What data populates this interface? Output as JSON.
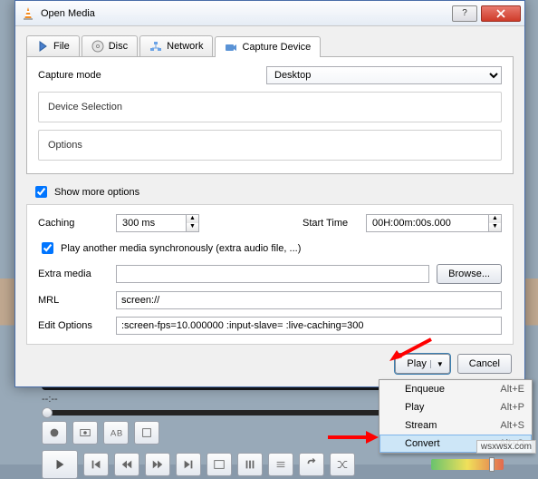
{
  "window": {
    "title": "Open Media"
  },
  "tabs": {
    "file": "File",
    "disc": "Disc",
    "network": "Network",
    "capture": "Capture Device"
  },
  "capture": {
    "mode_label": "Capture mode",
    "mode_value": "Desktop",
    "device_selection_label": "Device Selection",
    "options_label": "Options"
  },
  "show_more_label": "Show more options",
  "adv": {
    "caching_label": "Caching",
    "caching_value": "300 ms",
    "start_label": "Start Time",
    "start_value": "00H:00m:00s.000",
    "play_sync_label": "Play another media synchronously (extra audio file, ...)",
    "extra_label": "Extra media",
    "extra_value": "",
    "browse_label": "Browse...",
    "mrl_label": "MRL",
    "mrl_value": "screen://",
    "edit_label": "Edit Options",
    "edit_value": ":screen-fps=10.000000 :input-slave= :live-caching=300"
  },
  "buttons": {
    "play": "Play",
    "cancel": "Cancel"
  },
  "menu": {
    "items": [
      {
        "label": "Enqueue",
        "shortcut": "Alt+E"
      },
      {
        "label": "Play",
        "shortcut": "Alt+P"
      },
      {
        "label": "Stream",
        "shortcut": "Alt+S"
      },
      {
        "label": "Convert",
        "shortcut": "Alt+O"
      }
    ],
    "highlight_index": 3
  },
  "player": {
    "time": "--:--"
  },
  "watermark": "wsxwsx.com"
}
